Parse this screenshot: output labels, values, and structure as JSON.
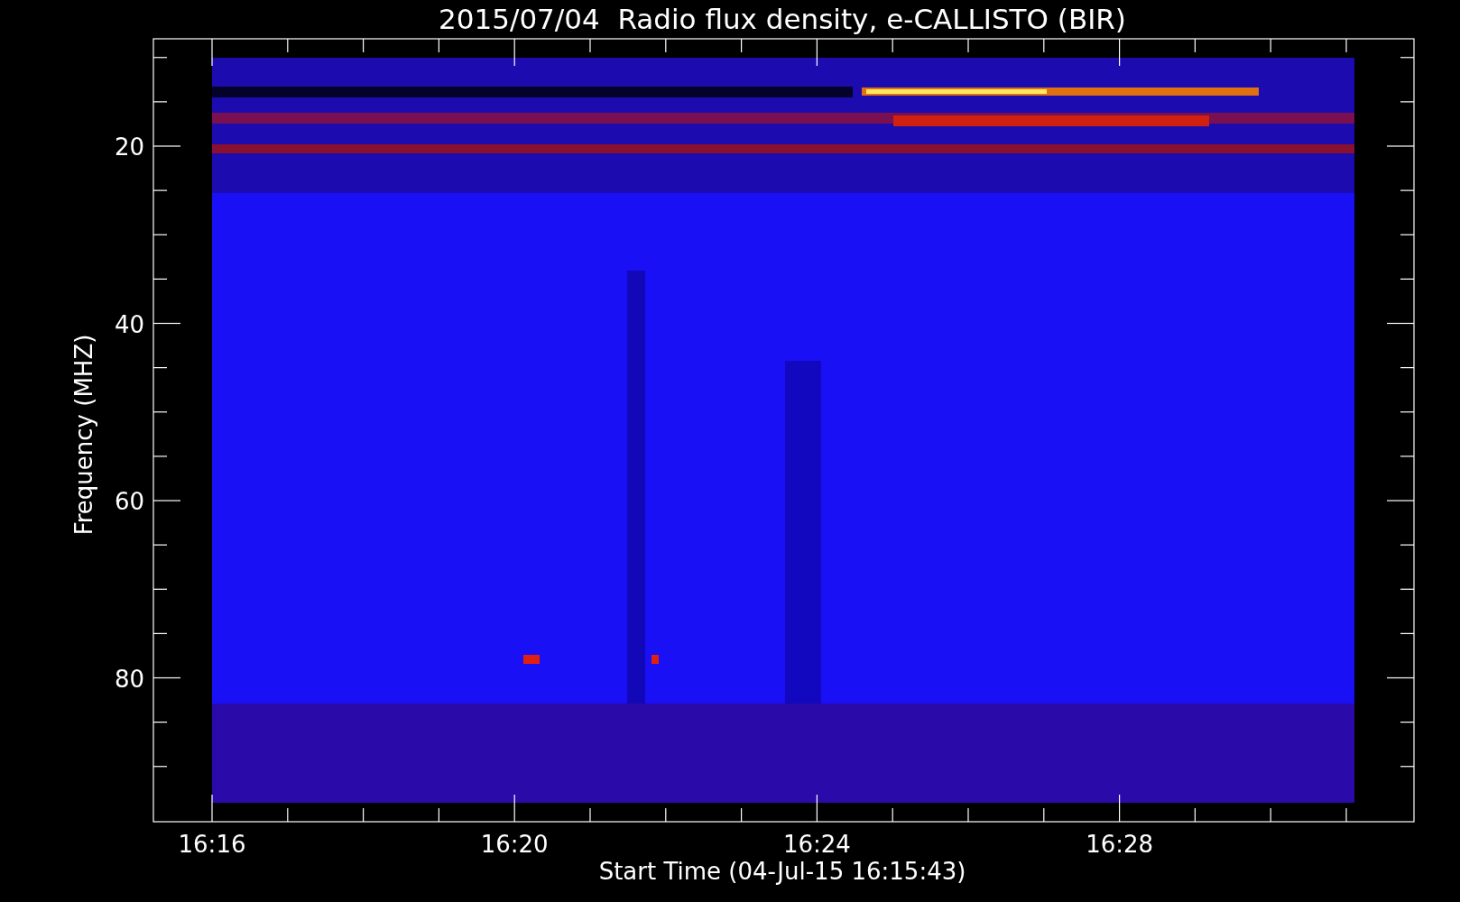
{
  "title": "2015/07/04  Radio flux density, e-CALLISTO (BIR)",
  "ylabel": "Frequency (MHZ)",
  "xlabel": "Start Time (04-Jul-15 16:15:43)",
  "yticks": [
    "20",
    "40",
    "60",
    "80"
  ],
  "xticks": [
    "16:16",
    "16:20",
    "16:24",
    "16:28"
  ]
}
